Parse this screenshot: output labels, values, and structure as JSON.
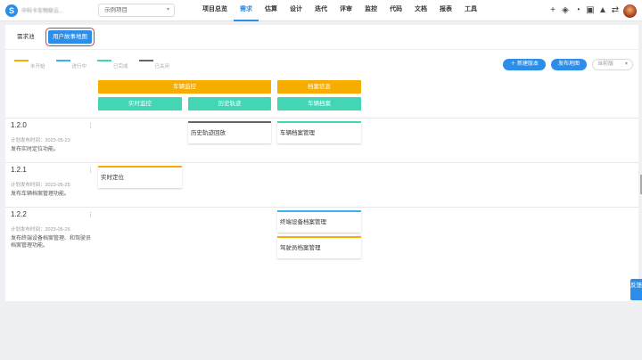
{
  "topbar": {
    "logo": "S",
    "org_name": "中科卡车物联云...",
    "project": "示例项目",
    "nav": [
      "项目总览",
      "需求",
      "估算",
      "设计",
      "迭代",
      "评审",
      "监控",
      "代码",
      "文档",
      "报表",
      "工具"
    ],
    "active_nav": "需求",
    "icons": [
      "+",
      "◈",
      "◔",
      "▣",
      "▲",
      "⇄"
    ]
  },
  "tabs": {
    "pool": "需求池",
    "story_map": "用户故事地图"
  },
  "legend": [
    {
      "label": "未开始",
      "color": "#f6ad00"
    },
    {
      "label": "进行中",
      "color": "#38b3f0"
    },
    {
      "label": "已完成",
      "color": "#43d6b5"
    },
    {
      "label": "已关闭",
      "color": "#666666"
    }
  ],
  "actions": {
    "new_version": "＋ 新建版本",
    "publish_map": "发布地图",
    "view_select": "当前版"
  },
  "epics": [
    "车辆监控",
    "档案信息"
  ],
  "features": [
    "实时监控",
    "历史轨迹",
    "车辆档案"
  ],
  "releases": [
    {
      "version": "1.2.0",
      "date": "计划发布时间：2023-05-23",
      "desc": "发布实时定位功能。"
    },
    {
      "version": "1.2.1",
      "date": "计划发布时间：2023-05-25",
      "desc": "发布车辆档案管理功能。"
    },
    {
      "version": "1.2.2",
      "date": "计划发布时间：2023-05-26",
      "desc": "发布终端设备档案管理、和驾驶员档案管理功能。"
    }
  ],
  "cards": [
    {
      "text": "历史轨迹回放",
      "color": "#666666"
    },
    {
      "text": "车辆档案管理",
      "color": "#43d6b5"
    },
    {
      "text": "实时定位",
      "color": "#f6ad00"
    },
    {
      "text": "终端设备档案管理",
      "color": "#38b3f0"
    },
    {
      "text": "驾驶员档案管理",
      "color": "#f6ad00"
    }
  ],
  "feedback": "反馈"
}
